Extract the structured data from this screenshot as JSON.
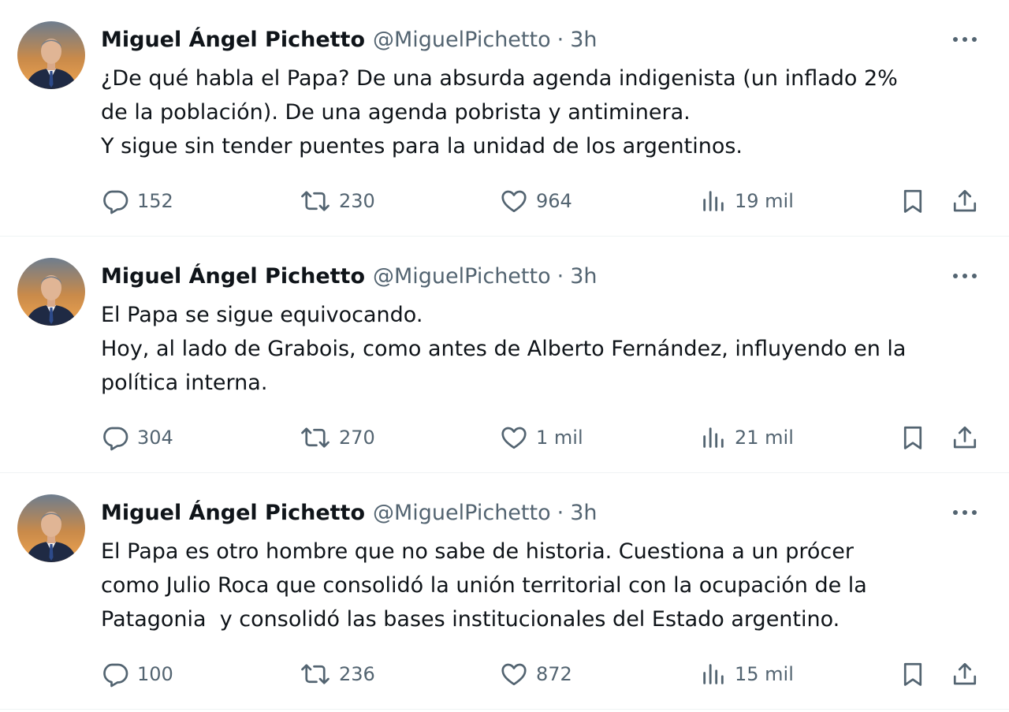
{
  "tweets": [
    {
      "author": {
        "name": "Miguel Ángel Pichetto",
        "handle": "@MiguelPichetto",
        "time": "3h"
      },
      "separator": "·",
      "lines": [
        "¿De qué habla el Papa? De una absurda agenda indigenista (un inflado 2%",
        "de la población). De una agenda pobrista y antiminera.",
        "Y sigue sin tender puentes para la unidad de los argentinos."
      ],
      "stats": {
        "replies": "152",
        "retweets": "230",
        "likes": "964",
        "views": "19 mil"
      }
    },
    {
      "author": {
        "name": "Miguel Ángel Pichetto",
        "handle": "@MiguelPichetto",
        "time": "3h"
      },
      "separator": "·",
      "lines": [
        "El Papa se sigue equivocando.",
        "Hoy, al lado de Grabois, como antes de Alberto Fernández, influyendo en la",
        "política interna."
      ],
      "stats": {
        "replies": "304",
        "retweets": "270",
        "likes": "1 mil",
        "views": "21 mil"
      }
    },
    {
      "author": {
        "name": "Miguel Ángel Pichetto",
        "handle": "@MiguelPichetto",
        "time": "3h"
      },
      "separator": "·",
      "lines": [
        "El Papa es otro hombre que no sabe de historia. Cuestiona a un prócer",
        "como Julio Roca que consolidó la unión territorial con la ocupación de la",
        "Patagonia  y consolidó las bases institucionales del Estado argentino."
      ],
      "stats": {
        "replies": "100",
        "retweets": "236",
        "likes": "872",
        "views": "15 mil"
      }
    }
  ],
  "icons": {
    "more": "more-horizontal-icon",
    "reply": "reply-bubble-icon",
    "retweet": "retweet-arrows-icon",
    "like": "heart-icon",
    "views": "bar-chart-icon",
    "bookmark": "bookmark-icon",
    "share": "share-upload-icon"
  },
  "colors": {
    "text": "#0f1419",
    "secondary": "#536471",
    "divider": "#eff3f4"
  }
}
